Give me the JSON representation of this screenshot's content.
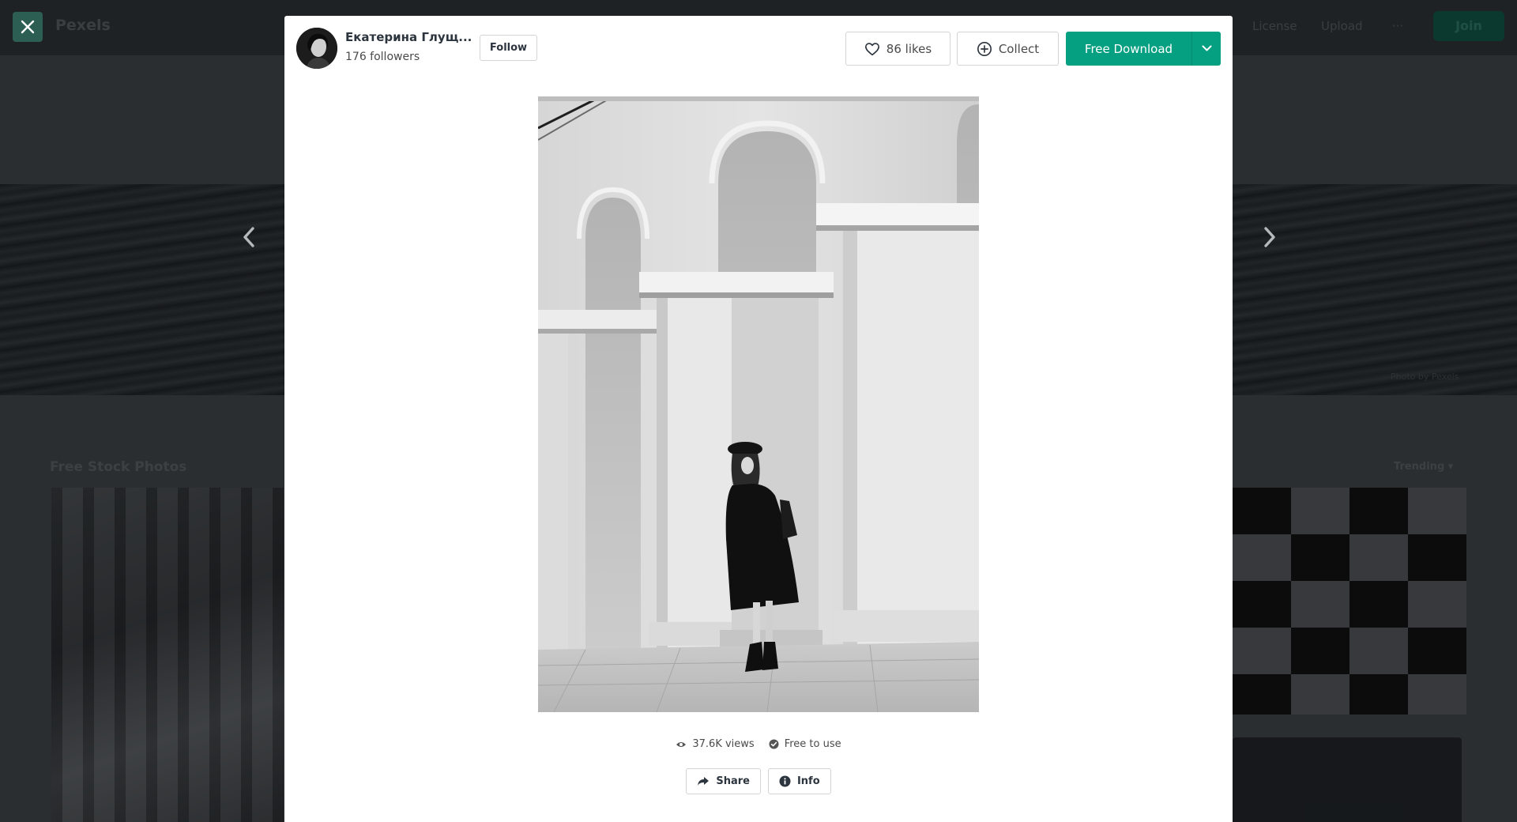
{
  "background": {
    "logo": "Pexels",
    "nav": [
      "License",
      "Upload",
      "···"
    ],
    "join_label": "Join",
    "hero_credit": "Photo by Pexels",
    "section_title": "Free Stock Photos",
    "sort_label": "Trending"
  },
  "modal": {
    "author": {
      "name": "Екатерина Глущ...",
      "followers": "176 followers",
      "follow_label": "Follow"
    },
    "toolbar": {
      "likes_label": "86 likes",
      "collect_label": "Collect",
      "download_label": "Free Download"
    },
    "stats": {
      "views": "37.6K views",
      "license": "Free to use"
    },
    "actions": {
      "share_label": "Share",
      "info_label": "Info"
    }
  },
  "icons": {
    "close": "close-icon",
    "prev": "chevron-left-icon",
    "next": "chevron-right-icon",
    "like": "heart-icon",
    "collect": "plus-circle-icon",
    "dropdown": "chevron-down-icon",
    "views": "eye-icon",
    "license": "check-circle-icon",
    "share": "share-arrow-icon",
    "info": "info-icon"
  },
  "colors": {
    "accent": "#05a081",
    "text_dark": "#2c343e",
    "border": "#d4d4d4"
  }
}
